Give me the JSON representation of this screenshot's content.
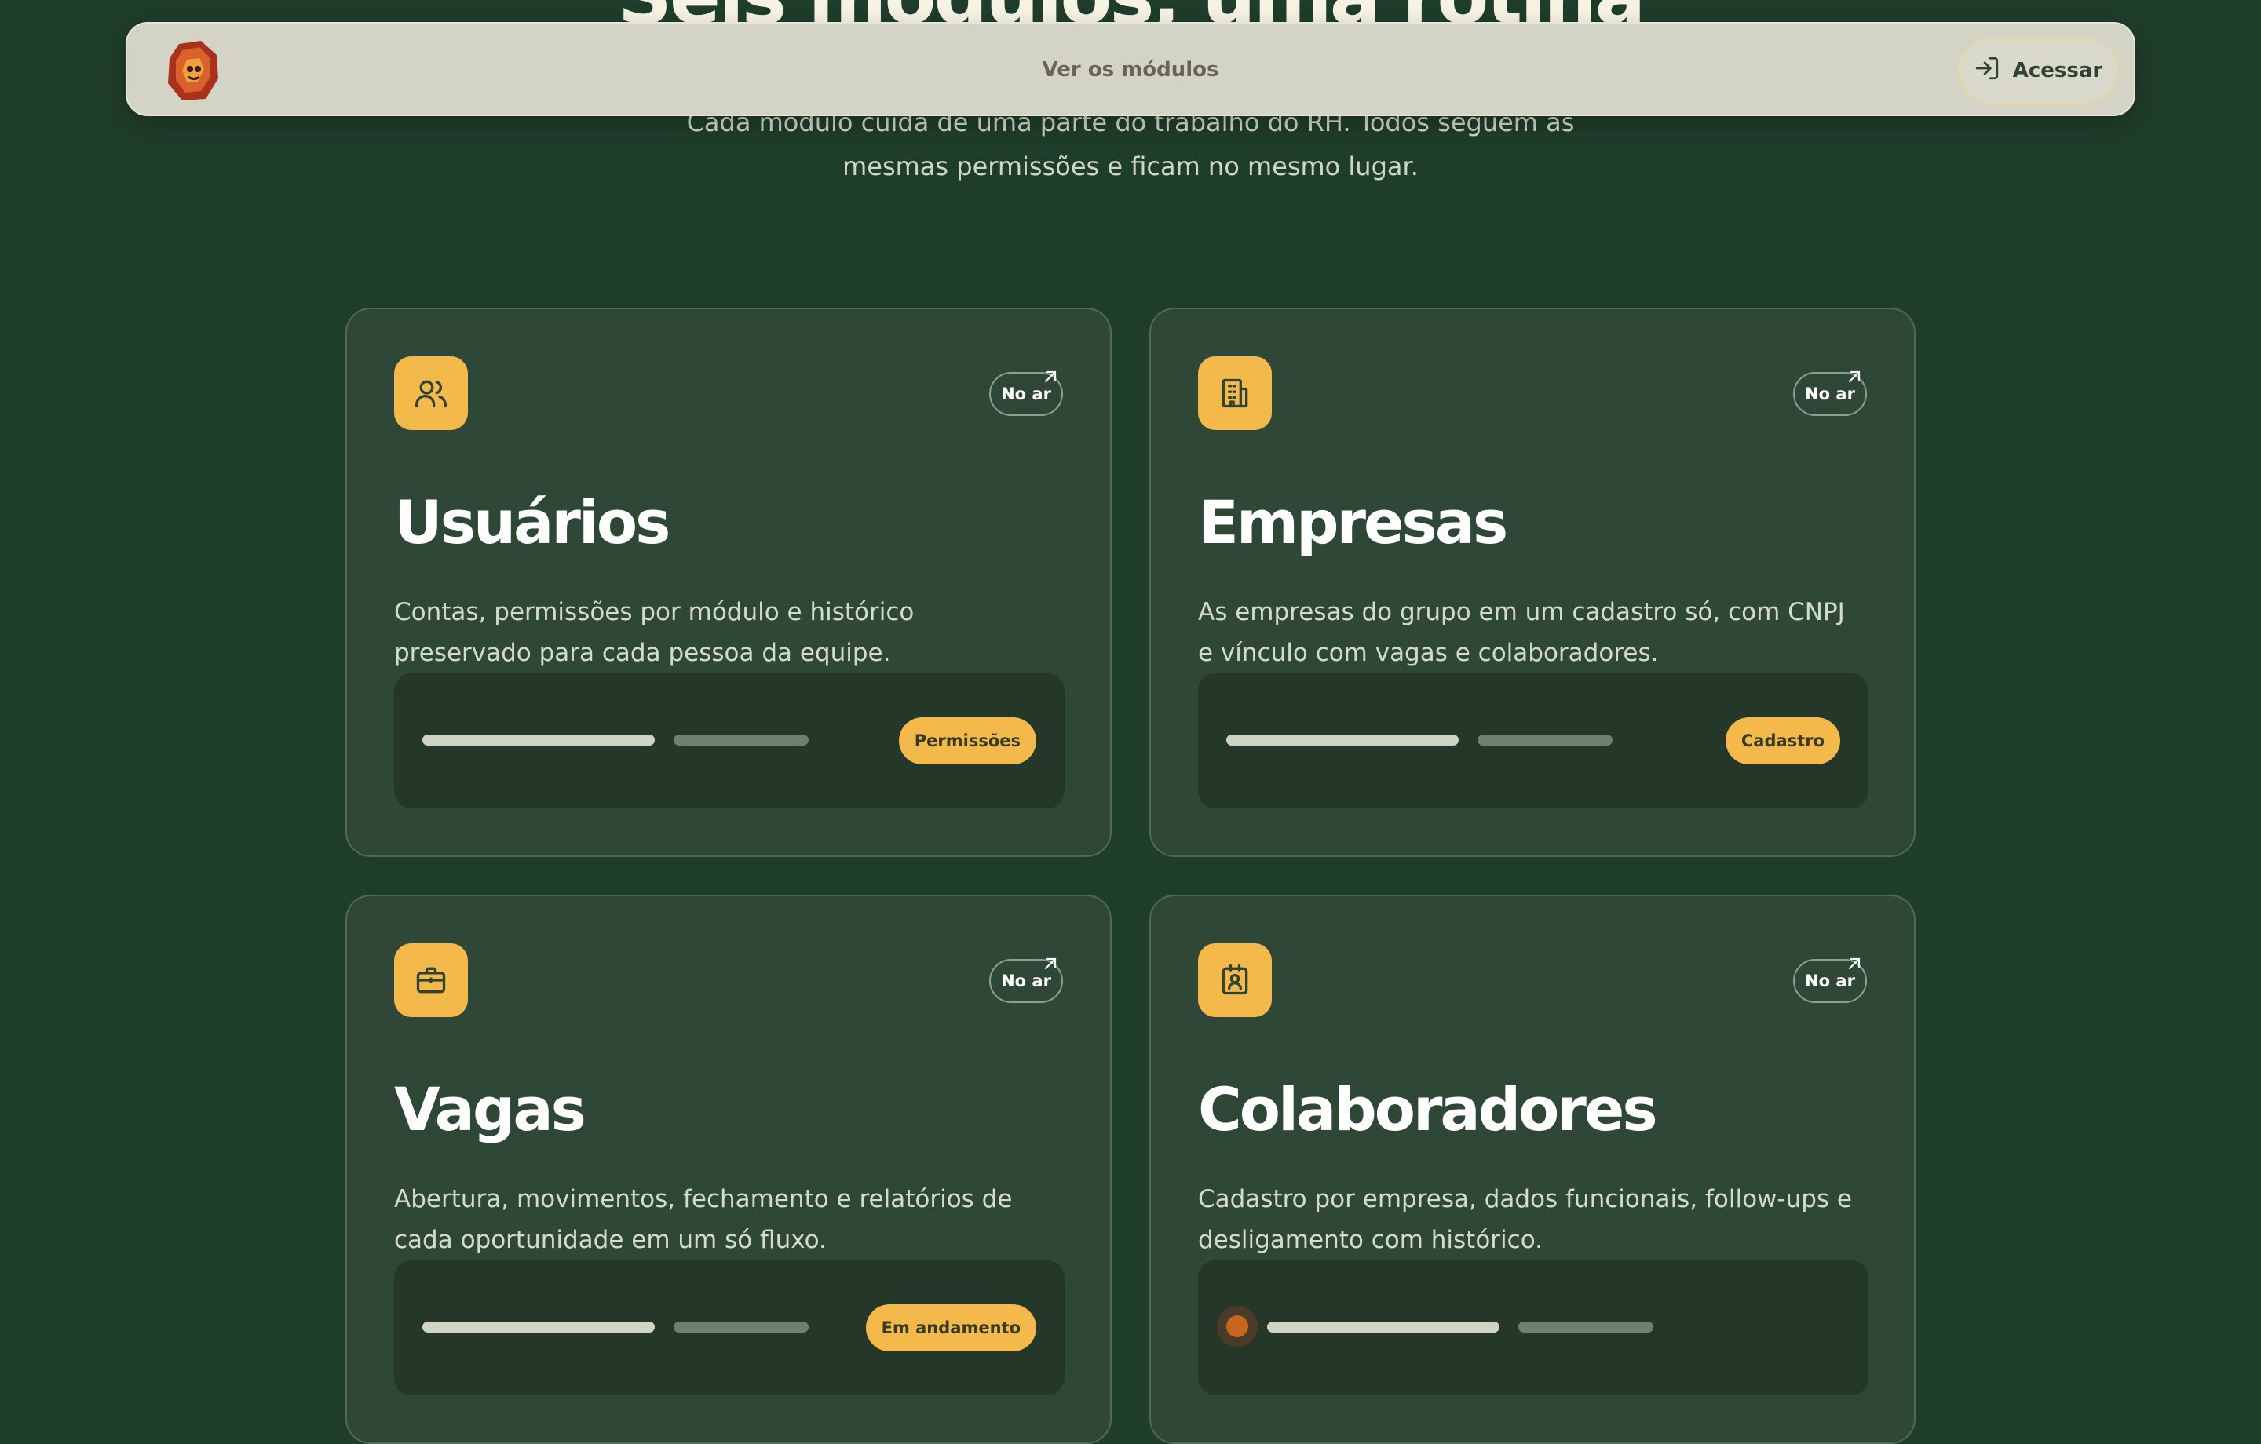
{
  "hero": {
    "title": "Seis módulos, uma rotina",
    "subtitle": "Cada módulo cuida de uma parte do trabalho do RH. Todos seguem as mesmas permissões e ficam no mesmo lugar."
  },
  "topbar": {
    "nav_link": "Ver os módulos",
    "login_label": "Acessar"
  },
  "colors": {
    "background": "#1f3d2b",
    "card": "#2f4737",
    "accent": "#f3b94a"
  },
  "modules": [
    {
      "title": "Usuários",
      "status": "No ar",
      "icon": "users-icon",
      "description": "Contas, permissões por módulo e histórico preservado para cada pessoa da equipe.",
      "tag": "Permissões"
    },
    {
      "title": "Empresas",
      "status": "No ar",
      "icon": "building-icon",
      "description": "As empresas do grupo em um cadastro só, com CNPJ e vínculo com vagas e colaboradores.",
      "tag": "Cadastro"
    },
    {
      "title": "Vagas",
      "status": "No ar",
      "icon": "briefcase-icon",
      "description": "Abertura, movimentos, fechamento e relatórios de cada oportunidade em um só fluxo.",
      "tag": "Em andamento"
    },
    {
      "title": "Colaboradores",
      "status": "No ar",
      "icon": "id-badge-icon",
      "description": "Cadastro por empresa, dados funcionais, follow-ups e desligamento com histórico.",
      "tag": ""
    }
  ]
}
